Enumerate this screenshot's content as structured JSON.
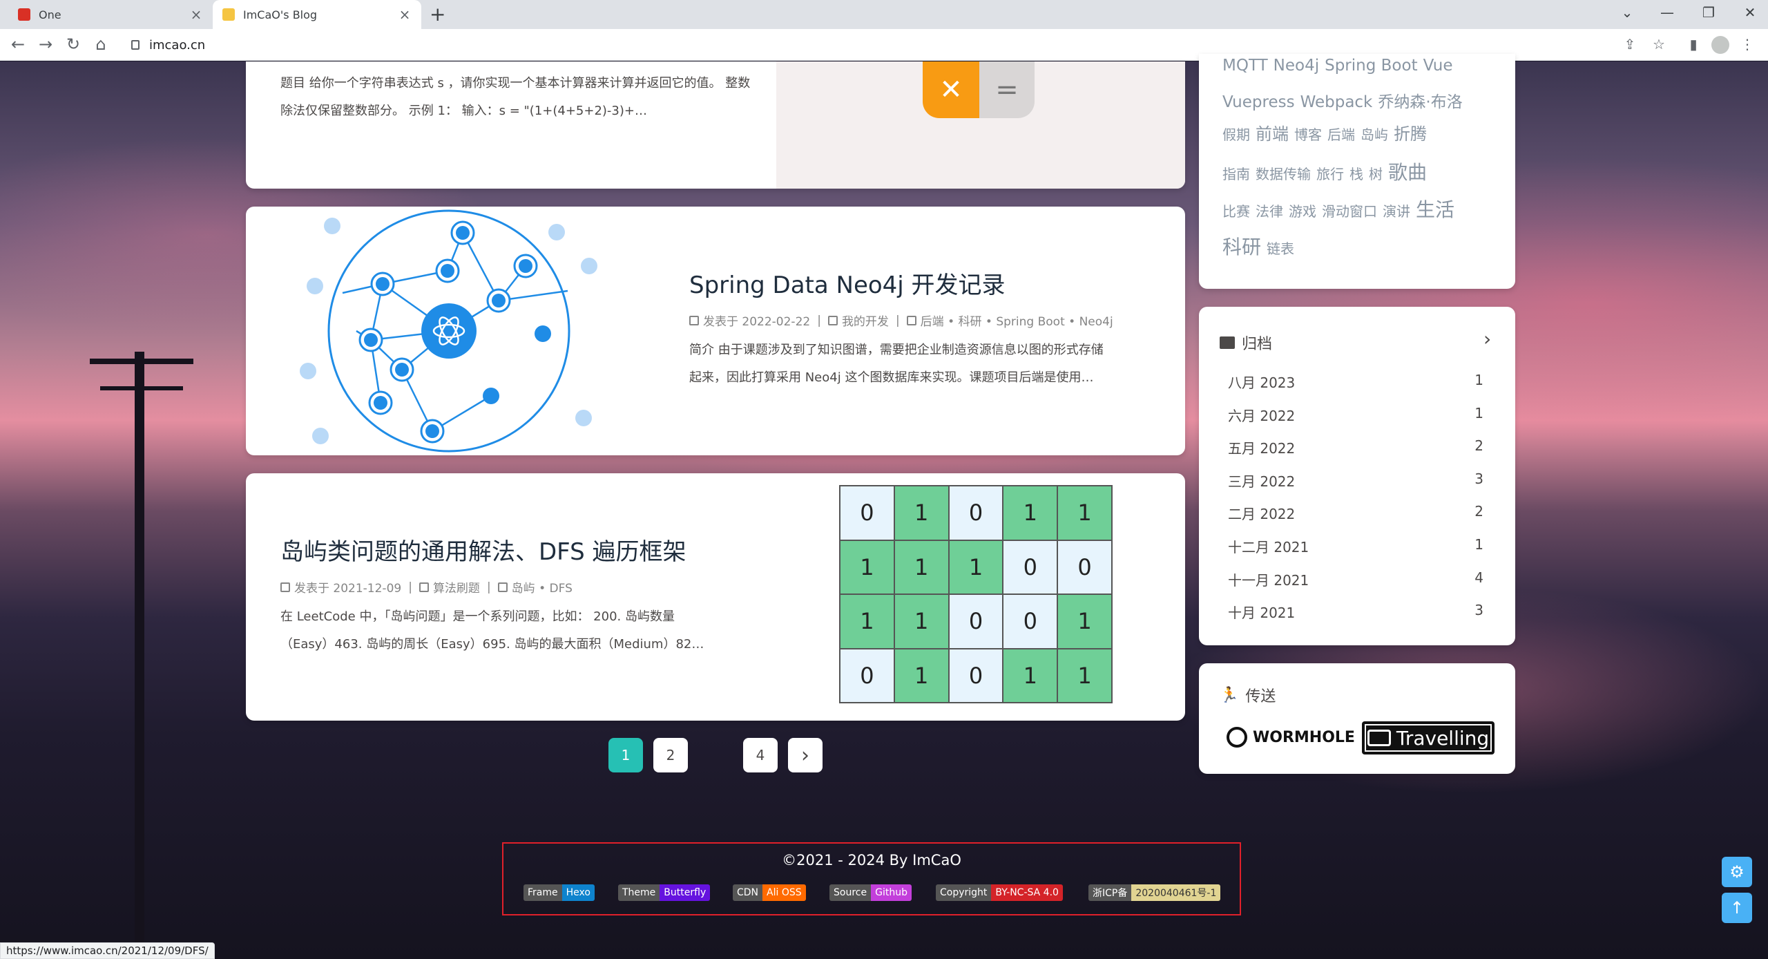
{
  "browser": {
    "tabs": [
      {
        "title": "One",
        "active": false
      },
      {
        "title": "ImCaO's Blog",
        "active": true
      }
    ],
    "url": "imcao.cn",
    "status_url": "https://www.imcao.cn/2021/12/09/DFS/"
  },
  "posts": [
    {
      "excerpt": "题目 给你一个字符串表达式 s ，请你实现一个基本计算器来计算并返回它的值。 整数除法仅保留整数部分。 示例 1： 输入：s = \"(1+(4+5+2)-3)+…"
    },
    {
      "title": "Spring Data Neo4j 开发记录",
      "date": "发表于 2022-02-22",
      "category": "我的开发",
      "tags": "后端 • 科研 • Spring Boot • Neo4j",
      "excerpt_1": "简介 由于课题涉及到了知识图谱，需要把企业制造资源信息以图的形式存储",
      "excerpt_2": "起来，因此打算采用 Neo4j 这个图数据库来实现。课题项目后端是使用…"
    },
    {
      "title": "岛屿类问题的通用解法、DFS 遍历框架",
      "date": "发表于 2021-12-09",
      "category": "算法刷题",
      "tags": "岛屿 • DFS",
      "excerpt_1": "在 LeetCode 中，「岛屿问题」是一个系列问题，比如： 200. 岛屿数量",
      "excerpt_2": "（Easy）463. 岛屿的周长（Easy）695. 岛屿的最大面积（Medium）82…"
    }
  ],
  "grid": [
    [
      0,
      1,
      0,
      1,
      1
    ],
    [
      1,
      1,
      1,
      0,
      0
    ],
    [
      1,
      1,
      0,
      0,
      1
    ],
    [
      0,
      1,
      0,
      1,
      1
    ]
  ],
  "pagination": [
    "1",
    "2",
    "4",
    "›"
  ],
  "sidebar": {
    "tag_rows": [
      [
        "MQTT",
        "Neo4j",
        "Spring Boot",
        "Vue"
      ],
      [
        "Vuepress",
        "Webpack",
        "乔纳森·布洛"
      ],
      [
        "假期",
        "前端",
        "博客",
        "后端",
        "岛屿",
        "折腾"
      ],
      [
        "指南",
        "数据传输",
        "旅行",
        "栈",
        "树",
        "歌曲"
      ],
      [
        "比赛",
        "法律",
        "游戏",
        "滑动窗口",
        "演讲",
        "生活"
      ],
      [
        "科研",
        "链表"
      ]
    ],
    "archive_title": "归档",
    "archive": [
      {
        "month": "八月 2023",
        "count": "1"
      },
      {
        "month": "六月 2022",
        "count": "1"
      },
      {
        "month": "五月 2022",
        "count": "2"
      },
      {
        "month": "三月 2022",
        "count": "3"
      },
      {
        "month": "二月 2022",
        "count": "2"
      },
      {
        "month": "十二月 2021",
        "count": "1"
      },
      {
        "month": "十一月 2021",
        "count": "4"
      },
      {
        "month": "十月 2021",
        "count": "3"
      }
    ],
    "portal_title": "传送",
    "wormhole": "WORMHOLE",
    "travelling": "Travelling"
  },
  "footer": {
    "copyright": "©2021 - 2024 By ImCaO",
    "badges": [
      {
        "label": "Frame",
        "value": "Hexo",
        "color": "#0e83cd"
      },
      {
        "label": "Theme",
        "value": "Butterfly",
        "color": "#6513df"
      },
      {
        "label": "CDN",
        "value": "Ali OSS",
        "color": "#ff6a00"
      },
      {
        "label": "Source",
        "value": "Github",
        "color": "#c33fdb"
      },
      {
        "label": "Copyright",
        "value": "BY-NC-SA 4.0",
        "color": "#d42328"
      },
      {
        "label": "浙ICP备",
        "value": "2020040461号-1",
        "color": "#e1d492"
      }
    ]
  }
}
